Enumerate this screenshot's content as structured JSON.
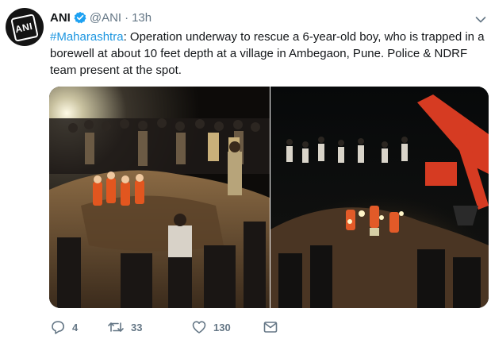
{
  "tweet": {
    "author_name": "ANI",
    "handle": "@ANI",
    "separator": "·",
    "time": "13h",
    "hashtag": "#Maharashtra",
    "body": ": Operation underway to rescue a 6-year-old boy, who is trapped in a borewell at about 10 feet depth at a village in Ambegaon, Pune. Police & NDRF team present at the spot.",
    "avatar_text": "ANI"
  },
  "actions": {
    "replies": "4",
    "retweets": "33",
    "likes": "130"
  },
  "icons": {
    "verified": "verified-badge-icon",
    "menu": "chevron-down-icon",
    "reply": "reply-icon",
    "retweet": "retweet-icon",
    "like": "heart-icon",
    "message": "envelope-icon"
  },
  "colors": {
    "link": "#1b95e0",
    "verified": "#1da1f2",
    "muted": "#657786",
    "text": "#14171a"
  }
}
